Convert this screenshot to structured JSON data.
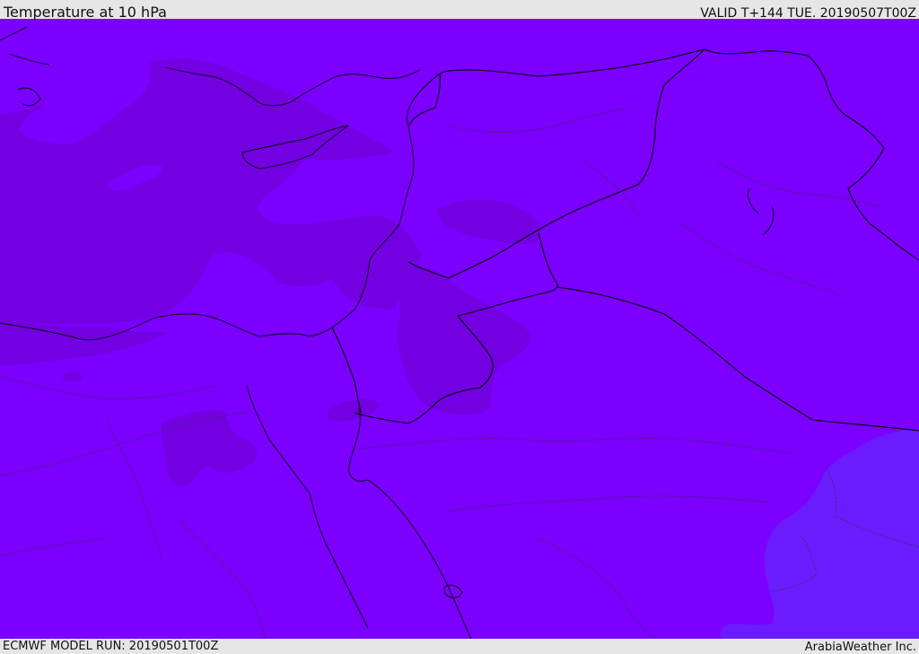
{
  "header": {
    "title": "Temperature at 10 hPa",
    "valid_time": "VALID T+144 TUE. 20190507T00Z"
  },
  "footer": {
    "model_run": "ECMWF MODEL RUN: 20190501T00Z",
    "credit": "ArabiaWeather Inc."
  },
  "map": {
    "field": "temperature",
    "level": "10 hPa",
    "colors": {
      "base_fill": "#7b00ff",
      "darker_band": "#7300e0",
      "lighter_band": "#6b1cff",
      "lighter_band_edge": "#6a25ff",
      "coastline": "#000000",
      "border": "#000000",
      "admin_border": "#333333"
    }
  }
}
